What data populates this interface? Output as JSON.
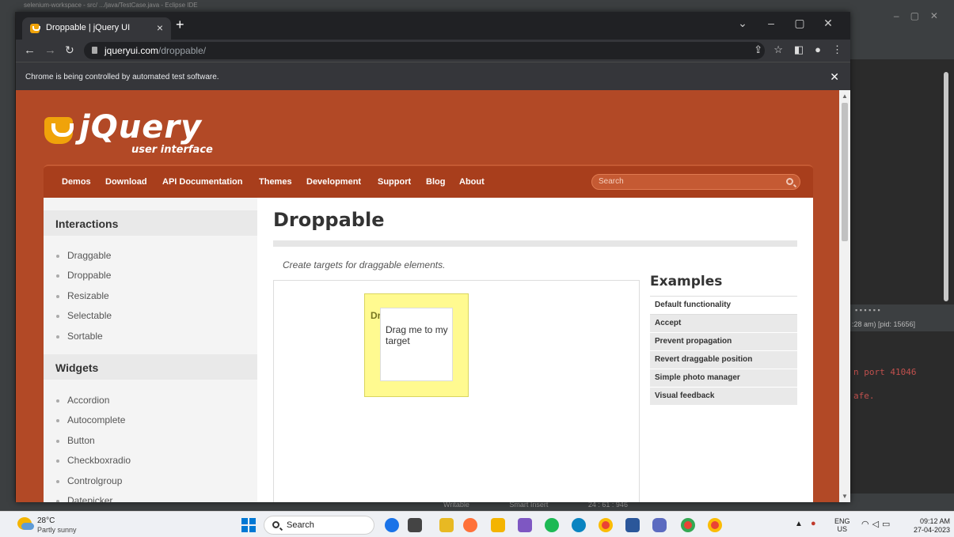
{
  "ide": {
    "top_text": "selenium-workspace - src/ .../java/TestCase.java - Eclipse IDE",
    "pid_text": ":28 am) [pid: 15656]",
    "console_lines": [
      "n port 41046",
      "afe."
    ],
    "status_writable": "Writable",
    "status_insert": "Smart Insert",
    "status_position": "24 : 61 : 946"
  },
  "browser": {
    "tab_title": "Droppable | jQuery UI",
    "url_host": "jqueryui.com",
    "url_path": "/droppable/",
    "infobar_text": "Chrome is being controlled by automated test software.",
    "accent": "#b24926"
  },
  "site": {
    "logo_name": "jQuery",
    "logo_sub": "user interface",
    "nav": [
      "Demos",
      "Download",
      "API Documentation",
      "Themes",
      "Development",
      "Support",
      "Blog",
      "About"
    ],
    "search_placeholder": "Search",
    "sidebar": {
      "interactions_title": "Interactions",
      "interactions": [
        "Draggable",
        "Droppable",
        "Resizable",
        "Selectable",
        "Sortable"
      ],
      "widgets_title": "Widgets",
      "widgets": [
        "Accordion",
        "Autocomplete",
        "Button",
        "Checkboxradio",
        "Controlgroup",
        "Datepicker"
      ]
    },
    "page_title": "Droppable",
    "description": "Create targets for draggable elements.",
    "droppable_label": "Dr",
    "draggable_label": "Drag me to my target",
    "examples_title": "Examples",
    "examples": [
      "Default functionality",
      "Accept",
      "Prevent propagation",
      "Revert draggable position",
      "Simple photo manager",
      "Visual feedback"
    ]
  },
  "taskbar": {
    "temperature": "28°C",
    "weather": "Partly sunny",
    "search_label": "Search",
    "lang_top": "ENG",
    "lang_bottom": "US",
    "time": "09:12 AM",
    "date": "27-04-2023"
  }
}
